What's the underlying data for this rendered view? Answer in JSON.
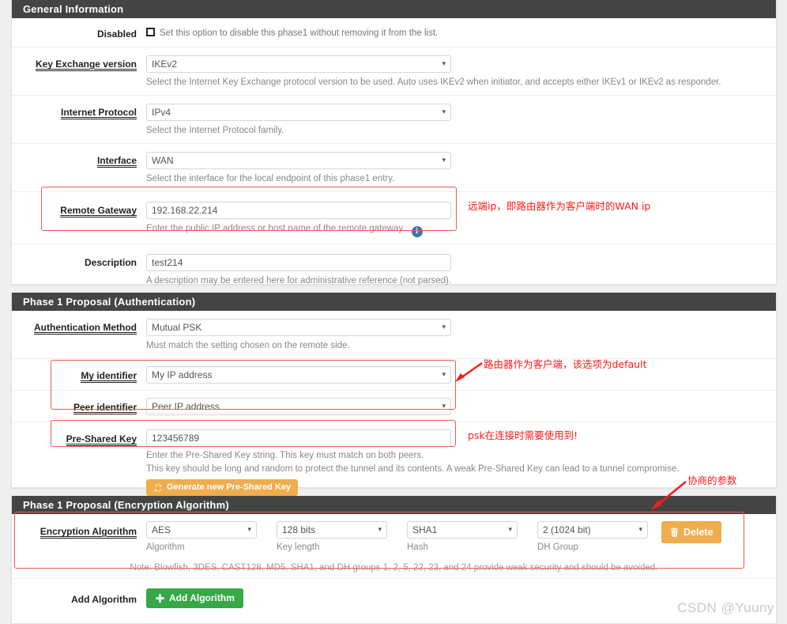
{
  "panels": {
    "general": {
      "title": "General Information",
      "rows": {
        "disabled": {
          "label": "Disabled",
          "checkbox_text": "Set this option to disable this phase1 without removing it from the list.",
          "checked": false
        },
        "key_exchange": {
          "label": "Key Exchange version",
          "value": "IKEv2",
          "help": "Select the Internet Key Exchange protocol version to be used. Auto uses IKEv2 when initiator, and accepts either IKEv1 or IKEv2 as responder."
        },
        "internet_protocol": {
          "label": "Internet Protocol",
          "value": "IPv4",
          "help": "Select the Internet Protocol family."
        },
        "interface": {
          "label": "Interface",
          "value": "WAN",
          "help": "Select the interface for the local endpoint of this phase1 entry."
        },
        "remote_gateway": {
          "label": "Remote Gateway",
          "value": "192.168.22.214",
          "help": "Enter the public IP address or host name of the remote gateway.",
          "info_icon": "info-circle-icon"
        },
        "description": {
          "label": "Description",
          "value": "test214",
          "help": "A description may be entered here for administrative reference (not parsed)."
        }
      }
    },
    "authentication": {
      "title": "Phase 1 Proposal (Authentication)",
      "rows": {
        "auth_method": {
          "label": "Authentication Method",
          "value": "Mutual PSK",
          "help": "Must match the setting chosen on the remote side."
        },
        "my_identifier": {
          "label": "My identifier",
          "value": "My IP address"
        },
        "peer_identifier": {
          "label": "Peer identifier",
          "value": "Peer IP address"
        },
        "pre_shared_key": {
          "label": "Pre-Shared Key",
          "value": "123456789",
          "help_line1": "Enter the Pre-Shared Key string. This key must match on both peers.",
          "help_line2": "This key should be long and random to protect the tunnel and its contents. A weak Pre-Shared Key can lead to a tunnel compromise.",
          "generate_button": "Generate new Pre-Shared Key",
          "generate_icon": "refresh-icon"
        }
      }
    },
    "encryption": {
      "title": "Phase 1 Proposal (Encryption Algorithm)",
      "rows": {
        "encryption_algorithm": {
          "label": "Encryption Algorithm",
          "columns": [
            {
              "value": "AES",
              "caption": "Algorithm"
            },
            {
              "value": "128 bits",
              "caption": "Key length"
            },
            {
              "value": "SHA1",
              "caption": "Hash"
            },
            {
              "value": "2 (1024 bit)",
              "caption": "DH Group"
            }
          ],
          "delete_button": "Delete",
          "delete_icon": "trash-icon"
        },
        "note": "Note: Blowfish, 3DES, CAST128, MD5, SHA1, and DH groups 1, 2, 5, 22, 23, and 24 provide weak security and should be avoided.",
        "add_algorithm": {
          "label": "Add Algorithm",
          "button": "Add Algorithm",
          "button_icon": "plus-icon"
        }
      }
    }
  },
  "annotations": [
    {
      "id": "remote-gateway-note",
      "text": "远端ip，即路由器作为客户端时的WAN ip"
    },
    {
      "id": "identifier-note",
      "text": "路由器作为客户端，该选项为default"
    },
    {
      "id": "psk-note",
      "text": "psk在连接时需要使用到!"
    },
    {
      "id": "proposal-note",
      "text": "协商的参数"
    }
  ],
  "watermark": "CSDN @Yuuny",
  "colors": {
    "panel_header": "#444444",
    "annotation_red": "#ff1a1a",
    "annotation_box": "#f05a50",
    "warning_button": "#efad4e",
    "success_button": "#37a747",
    "info_icon": "#337ab7"
  }
}
